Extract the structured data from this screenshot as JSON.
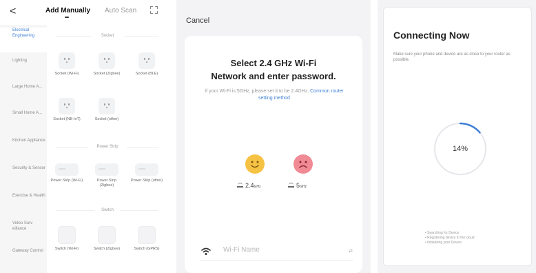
{
  "add_device": {
    "back_glyph": "<",
    "tabs": {
      "manual": "Add Manually",
      "auto": "Auto Scan"
    },
    "categories": [
      "Electrical Engineering",
      "Lighting",
      "Large Home A...",
      "Small Home A...",
      "Kitchen Appliance",
      "Security & Sensor",
      "Exercise & Health",
      "Video Surv eillance",
      "Gateway Control"
    ],
    "sections": {
      "socket": "Socket",
      "power_strip": "Power Strip",
      "switch": "Switch"
    },
    "sockets": [
      "Socket (Wi-Fi)",
      "Socket (Zigbee)",
      "Socket (BLE)",
      "Socket (NB-IoT)",
      "Socket (other)"
    ],
    "strips": [
      "Power Strip (Wi-Fi)",
      "Power Strip (Zigbee)",
      "Power Strip (other)"
    ],
    "switches": [
      "Switch (Wi-Fi)",
      "Switch (Zigbee)",
      "Switch (GPRS)"
    ]
  },
  "wifi": {
    "cancel": "Cancel",
    "title_line1": "Select 2.4 GHz Wi-Fi",
    "title_line2": "Network and enter password.",
    "subtitle": "If your Wi-Fi is 5GHz, please set it to be 2.4GHz.",
    "link": "Common router setting method",
    "band_24": "2.4",
    "band_5": "5",
    "unit": "GHz",
    "name_placeholder": "Wi-Fi Name",
    "swap_label": "⇄"
  },
  "connecting": {
    "title": "Connecting Now",
    "desc": "Make sure your phone and device are as close to your router as possible.",
    "progress_label": "14%",
    "progress": 0.14,
    "steps": [
      "Searching for Device",
      "Registering device to the cloud",
      "Initializing your Device"
    ]
  },
  "colors": {
    "accent": "#3d7fd6",
    "happy": "#f6c244",
    "sad": "#f08a94"
  }
}
